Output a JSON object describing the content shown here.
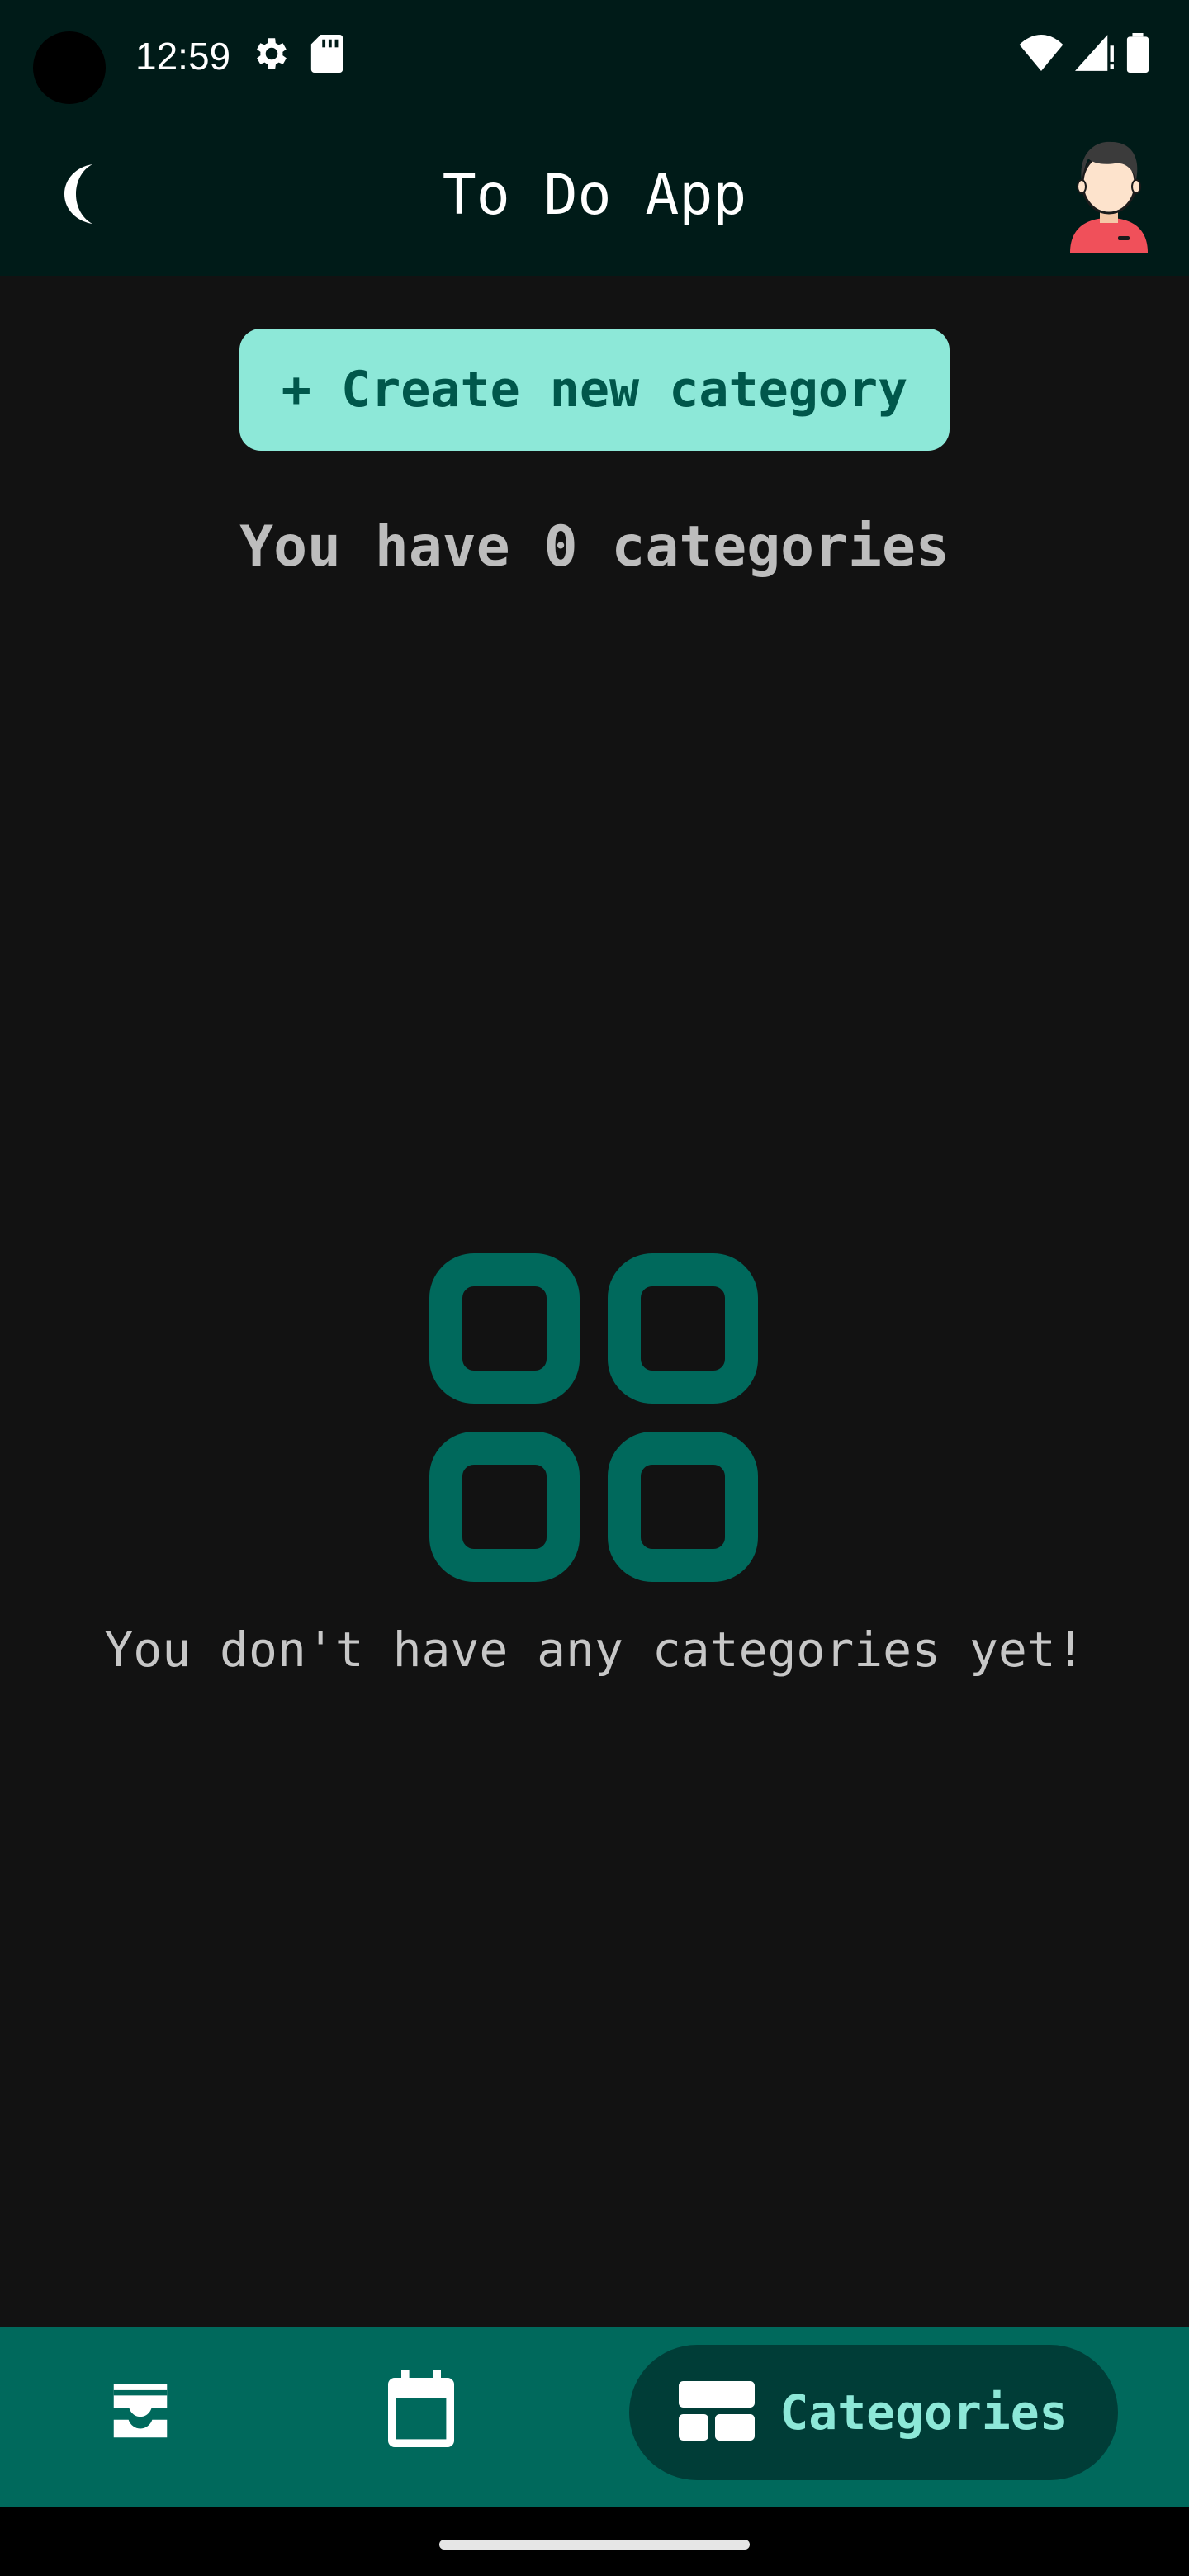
{
  "status_bar": {
    "time": "12:59",
    "left_icons": [
      "settings-icon",
      "sd-card-icon"
    ],
    "right_icons": [
      "wifi-icon",
      "signal-icon",
      "battery-icon"
    ]
  },
  "app_bar": {
    "title": "To Do App",
    "theme_icon": "moon-icon",
    "avatar_icon": "avatar"
  },
  "main": {
    "create_button_label": "+ Create new category",
    "count_text": "You have 0 categories",
    "empty_icon": "category-grid-icon",
    "empty_text": "You don't have any categories yet!"
  },
  "bottom_nav": {
    "items": [
      {
        "icon": "inbox-icon",
        "label": ""
      },
      {
        "icon": "calendar-icon",
        "label": ""
      },
      {
        "icon": "categories-icon",
        "label": "Categories",
        "selected": true
      }
    ]
  },
  "colors": {
    "app_bar": "#001b18",
    "background": "#121212",
    "accent": "#8de8d8",
    "accent_text": "#00574b",
    "nav_background": "#00695c",
    "nav_selected": "#003d37",
    "empty_icon": "#00695c"
  }
}
